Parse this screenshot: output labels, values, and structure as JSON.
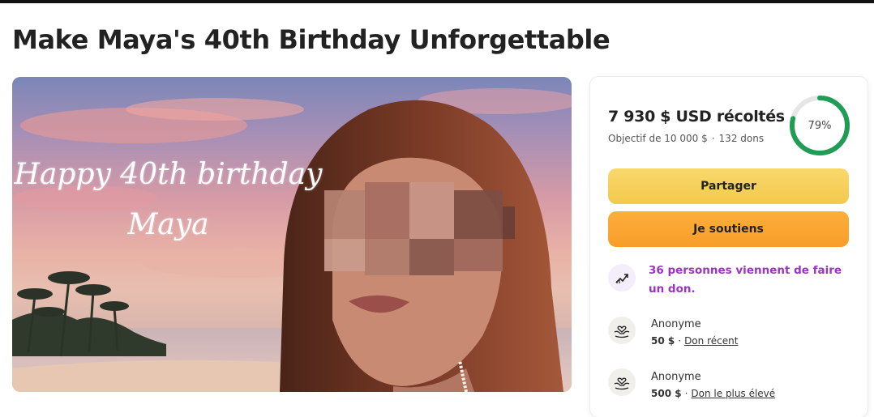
{
  "page": {
    "title": "Make Maya's 40th Birthday Unforgettable"
  },
  "hero": {
    "caption_line1": "Happy 40th birthday",
    "caption_line2": "Maya"
  },
  "fundraiser": {
    "raised_label": "7 930 $ USD récoltés",
    "goal_text": "Objectif de 10 000 $",
    "separator": "·",
    "donations_count": "132 dons",
    "progress_label": "79%",
    "progress_fraction": 0.79,
    "ring_color": "#1f9d55"
  },
  "actions": {
    "share_label": "Partager",
    "donate_label": "Je soutiens"
  },
  "activity": {
    "recent_text": "36 personnes viennent de faire un don.",
    "icon": "trending-up-icon"
  },
  "donors": [
    {
      "name": "Anonyme",
      "amount": "50 $",
      "separator": "·",
      "tag": "Don récent",
      "icon": "heart-hands-icon"
    },
    {
      "name": "Anonyme",
      "amount": "500 $",
      "separator": "·",
      "tag": "Don le plus élevé",
      "icon": "heart-hands-icon"
    }
  ]
}
